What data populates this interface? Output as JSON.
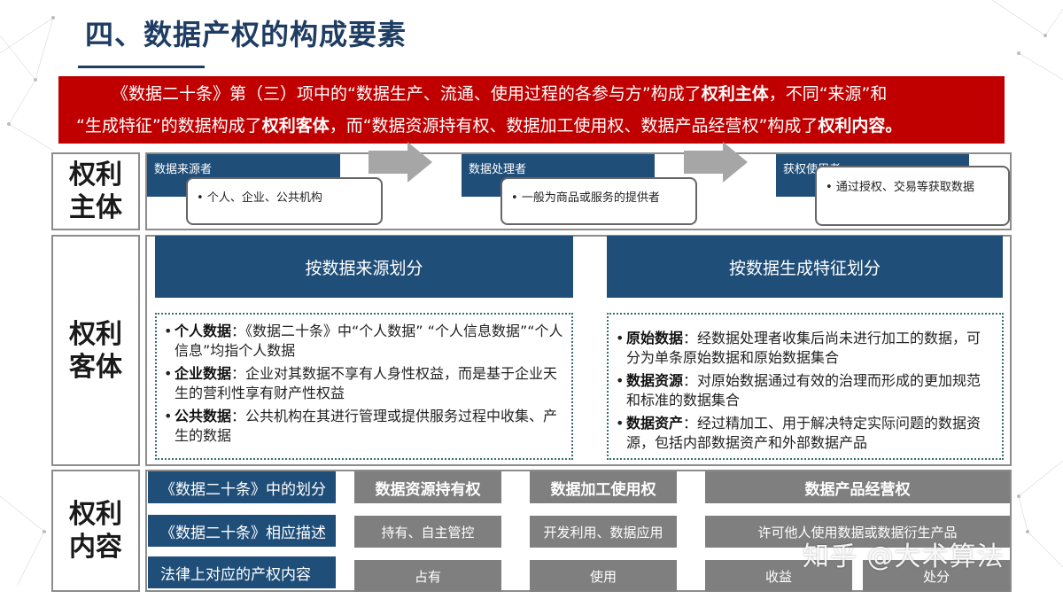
{
  "title": "四、数据产权的构成要素",
  "banner": {
    "line1_a": "《数据二十条》第（三）项中的“数据生产、流通、使用过程的各参与方”构成了",
    "line1_b": "权利主体",
    "line1_c": "，不同“来源”和",
    "line2_a": "“生成特征”的数据构成了",
    "line2_b": "权利客体",
    "line2_c": "，而“数据资源持有权、数据加工使用权、数据产品经营权”构成了",
    "line2_d": "权利内容。"
  },
  "row1": {
    "label": "权利\n主体",
    "items": [
      {
        "tag": "数据来源者",
        "desc": "个人、企业、公共机构"
      },
      {
        "tag": "数据处理者",
        "desc": "一般为商品或服务的提供者"
      },
      {
        "tag": "获权使用者",
        "desc": "通过授权、交易等获取数据"
      }
    ]
  },
  "row2": {
    "label": "权利\n客体",
    "left": {
      "header": "按数据来源划分",
      "items": [
        {
          "term": "个人数据",
          "text": "：《数据二十条》中“个人数据” “个人信息数据”“个人信息”均指个人数据"
        },
        {
          "term": "企业数据",
          "text": "：企业对其数据不享有人身性权益，而是基于企业天生的营利性享有财产性权益"
        },
        {
          "term": "公共数据",
          "text": "：公共机构在其进行管理或提供服务过程中收集、产生的数据"
        }
      ]
    },
    "right": {
      "header": "按数据生成特征划分",
      "items": [
        {
          "term": "原始数据",
          "text": "：经数据处理者收集后尚未进行加工的数据，可分为单条原始数据和原始数据集合"
        },
        {
          "term": "数据资源",
          "text": "：对原始数据通过有效的治理而形成的更加规范和标准的数据集合"
        },
        {
          "term": "数据资产",
          "text": "：经过精加工、用于解决特定实际问题的数据资源，包括内部数据资产和外部数据产品"
        }
      ]
    }
  },
  "row3": {
    "label": "权利\n内容",
    "rows": [
      {
        "label": "《数据二十条》中的划分",
        "cells": [
          "数据资源持有权",
          "数据加工使用权",
          "数据产品经营权"
        ]
      },
      {
        "label": "《数据二十条》相应描述",
        "cells": [
          "持有、自主管控",
          "开发利用、数据应用",
          "许可他人使用数据或数据衍生产品"
        ]
      },
      {
        "label": "法律上对应的产权内容",
        "cells": [
          "占有",
          "使用",
          "收益",
          "处分"
        ]
      }
    ]
  },
  "watermark": "知乎 @大术算法"
}
